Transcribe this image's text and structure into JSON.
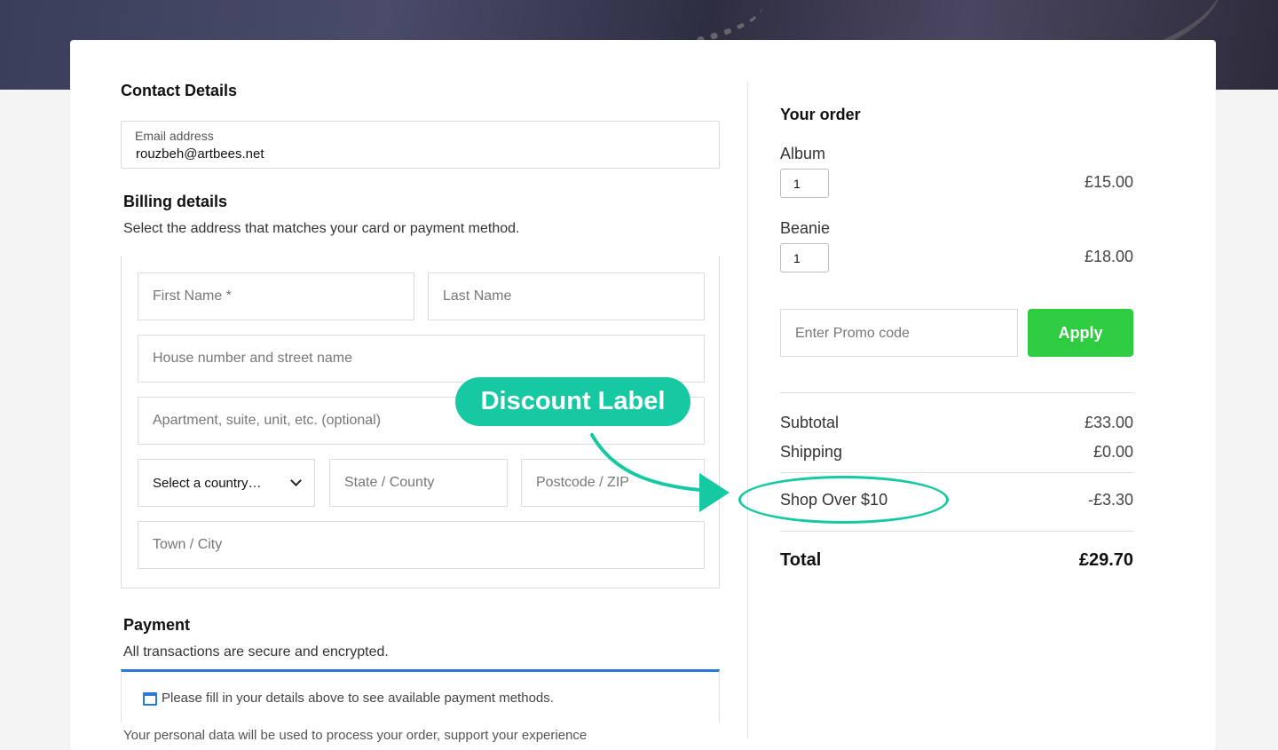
{
  "contact": {
    "title": "Contact Details",
    "email_label": "Email address",
    "email_value": "rouzbeh@artbees.net"
  },
  "billing": {
    "title": "Billing details",
    "subtitle": "Select the address that matches your card or payment method.",
    "first_name_placeholder": "First Name *",
    "last_name_placeholder": "Last Name",
    "street_placeholder": "House number and street name",
    "apartment_placeholder": "Apartment, suite, unit, etc. (optional)",
    "country_value": "Select a country…",
    "state_placeholder": "State / County",
    "postcode_placeholder": "Postcode / ZIP",
    "city_placeholder": "Town / City"
  },
  "payment": {
    "title": "Payment",
    "subtitle": "All transactions are secure and encrypted.",
    "notice": "Please fill in your details above to see available payment methods.",
    "notice_icon": "browser-window-icon",
    "accent_color": "#2a7bd8",
    "trailing_text": "Your personal data will be used to process your order, support your experience"
  },
  "order": {
    "title": "Your order",
    "items": [
      {
        "name": "Album",
        "qty": "1",
        "price": "£15.00"
      },
      {
        "name": "Beanie",
        "qty": "1",
        "price": "£18.00"
      }
    ],
    "promo_placeholder": "Enter Promo code",
    "apply_label": "Apply",
    "apply_color": "#2ecc40",
    "subtotal_label": "Subtotal",
    "subtotal_value": "£33.00",
    "shipping_label": "Shipping",
    "shipping_value": "£0.00",
    "discount_label": "Shop Over $10",
    "discount_value": "-£3.30",
    "total_label": "Total",
    "total_value": "£29.70"
  },
  "annotation": {
    "callout_text": "Discount Label",
    "color": "#17c9a2"
  }
}
